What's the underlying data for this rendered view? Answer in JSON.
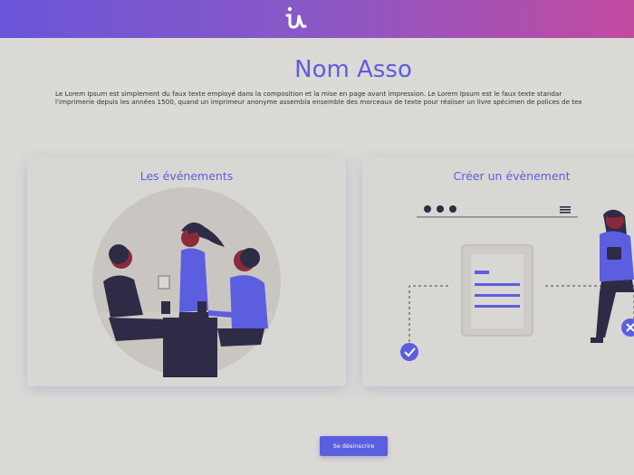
{
  "header": {
    "logo_icon": "iu-logo-icon",
    "gradient_start": "#6a55d8",
    "gradient_end": "#c24aa0"
  },
  "page": {
    "title": "Nom Asso",
    "description_line1": "Le Lorem Ipsum est simplement du faux texte employé dans la composition et la mise en page avant impression. Le Lorem Ipsum est le faux texte standar",
    "description_line2": "l'imprimerie depuis les années 1500, quand un imprimeur anonyme assembla ensemble des morceaux de texte pour réaliser un livre spécimen de polices de tex"
  },
  "cards": [
    {
      "title": "Les événements",
      "illustration": "people-meeting-illustration"
    },
    {
      "title": "Créer un évènement",
      "illustration": "create-event-illustration"
    }
  ],
  "actions": {
    "unsubscribe_label": "Se désinscrire"
  },
  "colors": {
    "accent": "#5c5ee0",
    "background": "#dcdad6",
    "card": "#d9d7d3"
  }
}
